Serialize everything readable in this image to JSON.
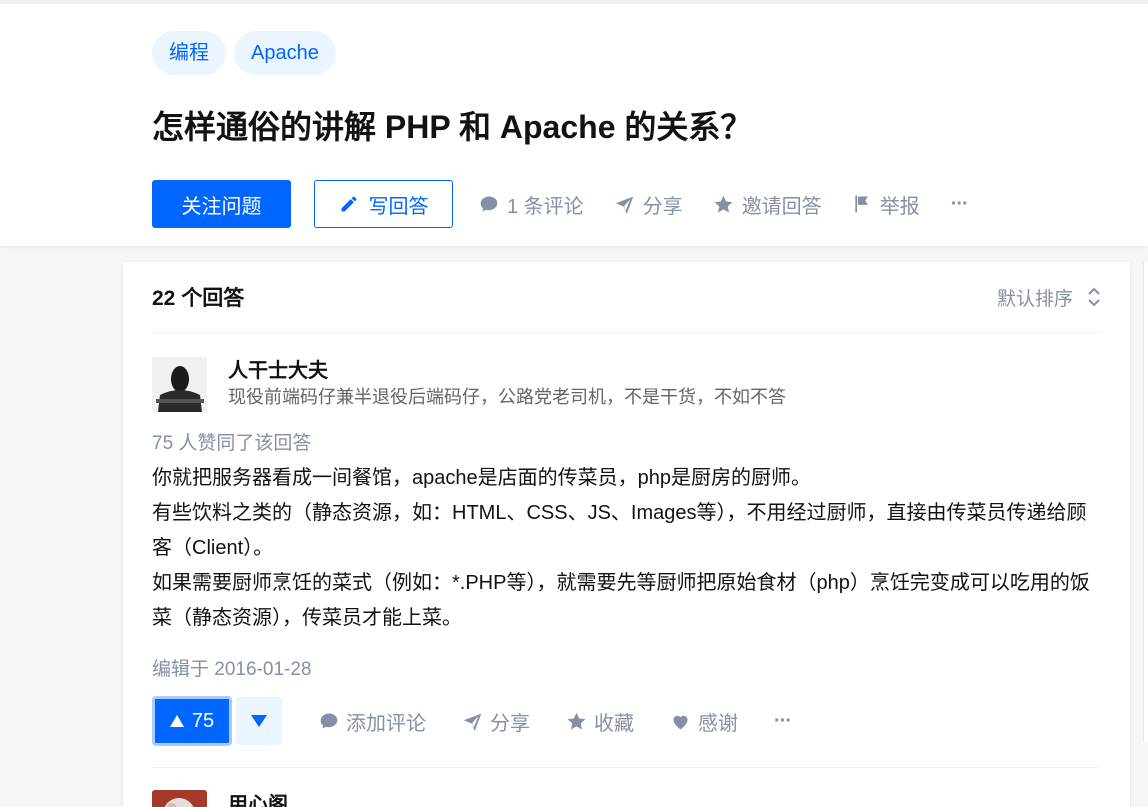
{
  "question": {
    "tags": [
      "编程",
      "Apache"
    ],
    "title": "怎样通俗的讲解 PHP 和 Apache 的关系？",
    "follow_label": "关注问题",
    "write_label": "写回答",
    "comments_label": "1 条评论",
    "share_label": "分享",
    "invite_label": "邀请回答",
    "report_label": "举报",
    "more_label": "···"
  },
  "answers": {
    "count_label": "22 个回答",
    "sort_label": "默认排序"
  },
  "answer": {
    "author_name": "人干士大夫",
    "author_bio": "现役前端码仔兼半退役后端码仔，公路党老司机，不是干货，不如不答",
    "voters_line": "75 人赞同了该回答",
    "paragraphs": [
      "你就把服务器看成一间餐馆，apache是店面的传菜员，php是厨房的厨师。",
      "有些饮料之类的（静态资源，如：HTML、CSS、JS、Images等），不用经过厨师，直接由传菜员传递给顾客（Client）。",
      "如果需要厨师烹饪的菜式（例如：*.PHP等），就需要先等厨师把原始食材（php）烹饪完变成可以吃用的饭菜（静态资源），传菜员才能上菜。"
    ],
    "edited": "编辑于 2016-01-28",
    "vote_count": "75",
    "comment_label": "添加评论",
    "share_label": "分享",
    "collect_label": "收藏",
    "thanks_label": "感谢",
    "more_label": "···"
  },
  "next_answer": {
    "author_name": "用心阁"
  },
  "colors": {
    "brand": "#0066ff",
    "muted": "#8590a6",
    "tag_bg": "#ebf5ff"
  }
}
